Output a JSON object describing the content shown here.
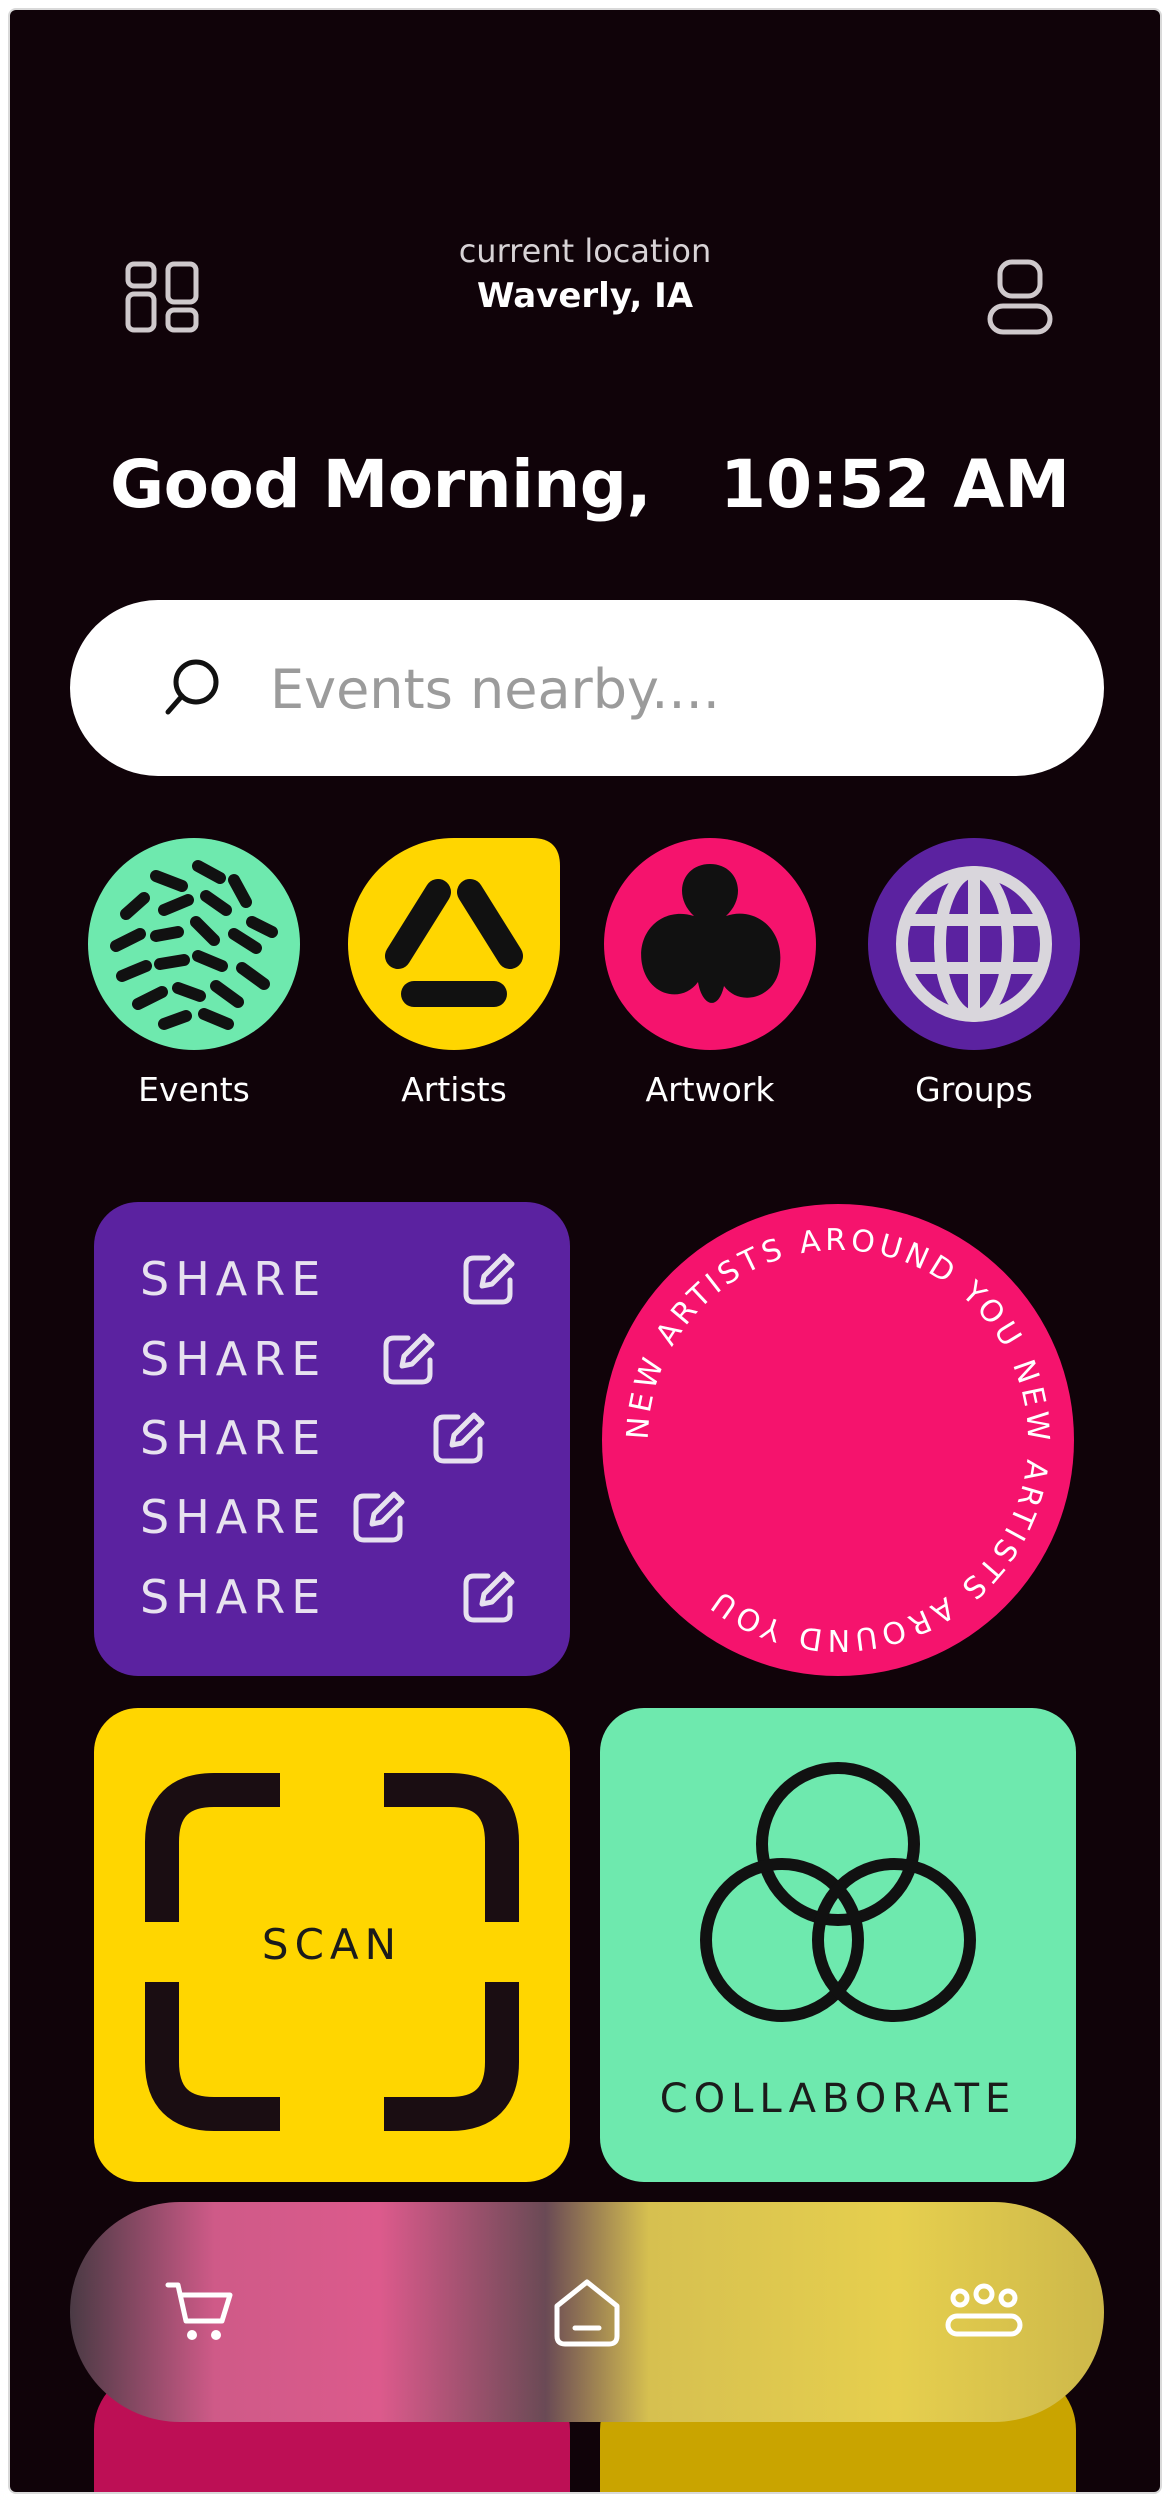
{
  "header": {
    "location_label": "current location",
    "location_value": "Waverly, IA",
    "menu_icon": "grid-icon",
    "profile_icon": "user-icon"
  },
  "greeting": "Good Morning,",
  "time": "10:52 AM",
  "search": {
    "placeholder": "Events nearby....",
    "value": "",
    "icon": "search-icon"
  },
  "categories": [
    {
      "label": "Events",
      "color": "#6ee9ae"
    },
    {
      "label": "Artists",
      "color": "#ffd600"
    },
    {
      "label": "Artwork",
      "color": "#f5136d"
    },
    {
      "label": "Groups",
      "color": "#5b22a0"
    }
  ],
  "tiles": {
    "share": {
      "rows": [
        "SHARE",
        "SHARE",
        "SHARE",
        "SHARE",
        "SHARE"
      ],
      "color": "#5b22a0"
    },
    "new_artists": {
      "text": "NEW ARTISTS AROUND YOU NEW ARTISTS AROUND YOU",
      "color": "#f5136d"
    },
    "scan": {
      "label": "SCAN",
      "color": "#ffd600"
    },
    "collaborate": {
      "label": "COLLABORATE",
      "color": "#6ee9ae"
    }
  },
  "nav": {
    "items": [
      {
        "name": "cart",
        "icon": "cart-icon"
      },
      {
        "name": "home",
        "icon": "home-icon"
      },
      {
        "name": "community",
        "icon": "group-icon"
      }
    ]
  },
  "colors": {
    "background": "#100309",
    "pink": "#f5136d",
    "yellow": "#ffd600",
    "green": "#6ee9ae",
    "purple": "#5b22a0"
  }
}
